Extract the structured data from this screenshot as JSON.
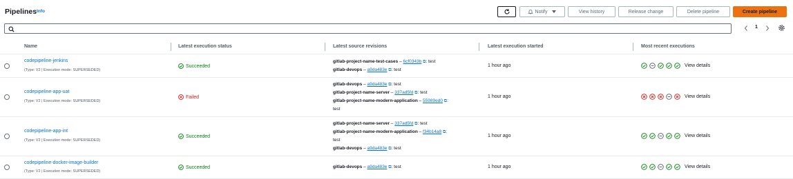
{
  "header": {
    "title": "Pipelines",
    "info": "Info",
    "buttons": {
      "notify": "Notify",
      "view_history": "View history",
      "release_change": "Release change",
      "delete_pipeline": "Delete pipeline",
      "create_pipeline": "Create pipeline"
    }
  },
  "search": {
    "placeholder": "",
    "value": ""
  },
  "pagination": {
    "current_page": "1"
  },
  "colors": {
    "accent": "#ec7211",
    "link": "#0972d3",
    "success": "#037f0c",
    "error": "#d91515"
  },
  "table": {
    "columns": {
      "name": "Name",
      "status": "Latest execution status",
      "revisions": "Latest source revisions",
      "started": "Latest execution started",
      "recent": "Most recent executions"
    },
    "rows": [
      {
        "name": "codepipeline-jenkins",
        "meta": "(Type: V2 | Execution mode: SUPERSEDED)",
        "status": "Succeeded",
        "started": "1 hour ago",
        "view_details": "View details",
        "rev1": {
          "repo": "gitlab-project-name-test-cases",
          "sep": " – ",
          "commit": "6cf0343b",
          "msg": ": test"
        },
        "rev2": {
          "repo": "gitlab-devops",
          "sep": " – ",
          "commit": "a9da483e",
          "msg": ": test"
        }
      },
      {
        "name": "codepipeline-app-uat",
        "meta": "(Type: V2 | Execution mode: SUPERSEDED)",
        "status": "Failed",
        "started": "1 hour ago",
        "view_details": "View details",
        "rev1": {
          "repo": "gitlab-devops",
          "sep": " – ",
          "commit": "a9da483e",
          "msg": ": test"
        },
        "rev2": {
          "repo": "gitlab-project-name-server",
          "sep": " – ",
          "commit": "337ad5fd",
          "msg": ": test"
        },
        "rev3": {
          "repo": "gitlab-project-name-modern-application",
          "sep": " – ",
          "commit": "55989ed0",
          "msg": ":"
        },
        "rev3_cont": "test"
      },
      {
        "name": "codepipeline-app-int",
        "meta": "(Type: V2 | Execution mode: SUPERSEDED)",
        "status": "Succeeded",
        "started": "1 hour ago",
        "view_details": "View details",
        "rev1": {
          "repo": "gitlab-project-name-server",
          "sep": " – ",
          "commit": "337ad5fd",
          "msg": ": test"
        },
        "rev2": {
          "repo": "gitlab-project-name-modern-application",
          "sep": " – ",
          "commit": "f34b14a8",
          "msg": ":"
        },
        "rev2_cont": "test",
        "rev3": {
          "repo": "gitlab-devops",
          "sep": " – ",
          "commit": "a9da483e",
          "msg": ": test"
        }
      },
      {
        "name": "codepipeline-docker-image-builder",
        "meta": "(Type: V2 | Execution mode: SUPERSEDED)",
        "status": "Succeeded",
        "started": "1 hour ago",
        "view_details": "View details",
        "rev1": {
          "repo": "gitlab-devops",
          "sep": " – ",
          "commit": "a9da483e",
          "msg": ": test"
        }
      }
    ]
  }
}
